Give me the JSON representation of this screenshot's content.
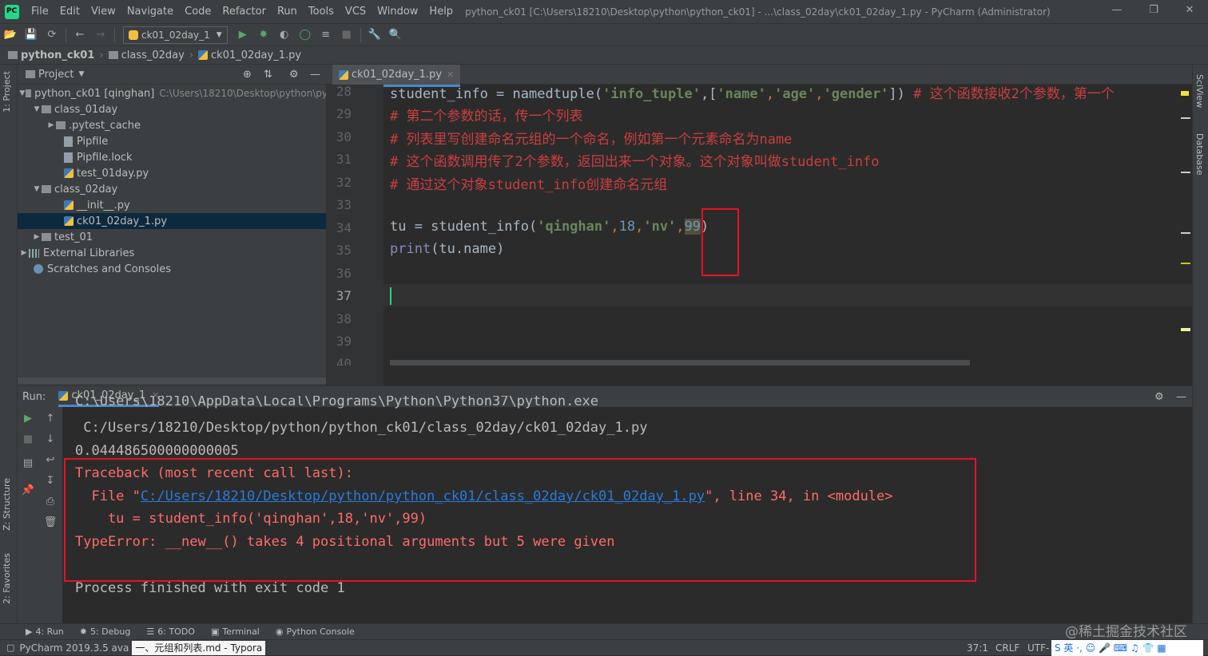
{
  "menubar": {
    "items": [
      "File",
      "Edit",
      "View",
      "Navigate",
      "Code",
      "Refactor",
      "Run",
      "Tools",
      "VCS",
      "Window",
      "Help"
    ],
    "title": "python_ck01 [C:\\Users\\18210\\Desktop\\python\\python_ck01] - ...\\class_02day\\ck01_02day_1.py - PyCharm (Administrator)"
  },
  "toolbar": {
    "run_config": "ck01_02day_1"
  },
  "navbar": {
    "crumbs": [
      "python_ck01",
      "class_02day",
      "ck01_02day_1.py"
    ]
  },
  "project": {
    "header": "Project",
    "tree": [
      {
        "label": "python_ck01 [qinghan]",
        "path": "C:\\Users\\18210\\Desktop\\python\\py"
      },
      {
        "label": "class_01day"
      },
      {
        "label": ".pytest_cache"
      },
      {
        "label": "Pipfile"
      },
      {
        "label": "Pipfile.lock"
      },
      {
        "label": "test_01day.py"
      },
      {
        "label": "class_02day"
      },
      {
        "label": "__init__.py"
      },
      {
        "label": "ck01_02day_1.py"
      },
      {
        "label": "test_01"
      },
      {
        "label": "External Libraries"
      },
      {
        "label": "Scratches and Consoles"
      }
    ]
  },
  "editor": {
    "tab": "ck01_02day_1.py",
    "line_numbers": [
      "28",
      "29",
      "30",
      "31",
      "32",
      "33",
      "34",
      "35",
      "36",
      "37",
      "38",
      "39",
      "40"
    ],
    "line28": {
      "a": "student_info = namedtuple(",
      "b": "'info_tuple'",
      "c": ",[",
      "d": "'name'",
      "e": ",",
      "f": "'age'",
      "g": ",",
      "h": "'gender'",
      "i": "]) ",
      "j": "# 这个函数接收2个参数，第一个"
    },
    "line29": "# 第二个参数的话，传一个列表",
    "line30": "# 列表里写创建命名元组的一个命名，例如第一个元素命名为name",
    "line31": "# 这个函数调用传了2个参数，返回出来一个对象。这个对象叫做student_info",
    "line32": "# 通过这个对象student_info创建命名元组",
    "line34": {
      "a": "tu = student_info(",
      "b": "'qinghan'",
      "c": ",",
      "d": "18",
      "e": ",",
      "f": "'nv'",
      "g": ",",
      "h": "99",
      "i": ")"
    },
    "line35": {
      "a": "print",
      "b": "(tu.name)"
    }
  },
  "run": {
    "label": "Run:",
    "tab": "ck01_02day_1",
    "out0": "C:\\Users\\18210\\AppData\\Local\\Programs\\Python\\Python37\\python.exe",
    "out1": " C:/Users/18210/Desktop/python/python_ck01/class_02day/ck01_02day_1.py",
    "out2": "0.044486500000000005",
    "tb0": "Traceback (most recent call last):",
    "tb1a": "  File \"",
    "tb1b": "C:/Users/18210/Desktop/python/python_ck01/class_02day/ck01_02day_1.py",
    "tb1c": "\", line 34, in <module>",
    "tb2": "    tu = student_info('qinghan',18,'nv',99)",
    "tb3": "TypeError: __new__() takes 4 positional arguments but 5 were given",
    "exit": "Process finished with exit code 1"
  },
  "toolwindows": [
    "4: Run",
    "5: Debug",
    "6: TODO",
    "Terminal",
    "Python Console"
  ],
  "side_tabs": {
    "left": [
      "1: Project",
      "Z: Structure",
      "2: Favorites"
    ],
    "right": [
      "SciView",
      "Database"
    ]
  },
  "status": {
    "left": "PyCharm 2019.3.5 ava",
    "typora": "一、元组和列表.md - Typora",
    "pos": "37:1",
    "crlf": "CRLF",
    "enc": "UTF-"
  },
  "watermark": "@稀土掘金技术社区",
  "colors": {
    "accent": "#4a88c7",
    "error": "#ff6b68",
    "highlight_box": "#e81123",
    "string": "#6a8759",
    "comment": "#cc3e3e"
  }
}
